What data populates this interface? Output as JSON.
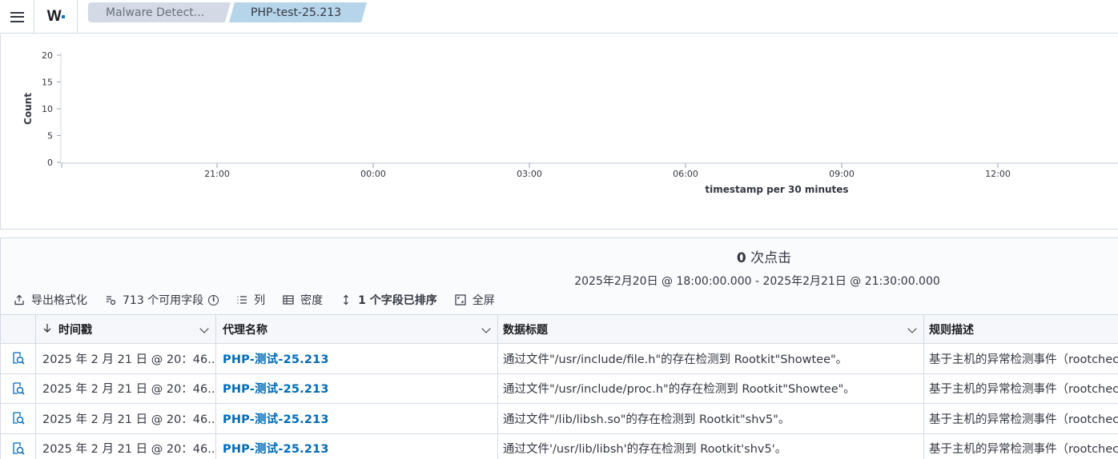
{
  "header": {
    "menu_icon": "hamburger-menu-icon",
    "logo_text": "W",
    "brand_color": "#0077cc",
    "breadcrumbs": [
      "Malware Detect...",
      "PHP-test-25.213"
    ]
  },
  "chart_data": {
    "type": "bar",
    "title": "",
    "xlabel": "timestamp per 30 minutes",
    "ylabel": "Count",
    "ylim": [
      0,
      20
    ],
    "y_ticks": [
      "0",
      "5",
      "10",
      "15",
      "20"
    ],
    "x_ticks": [
      "21:00",
      "00:00",
      "03:00",
      "06:00",
      "09:00",
      "12:00"
    ],
    "series": [],
    "grid": false
  },
  "hits": {
    "count": "0",
    "label": " 次点击",
    "time_range": "2025年2月20日 @ 18:00:00.000 - 2025年2月21日 @ 21:30:00.000"
  },
  "toolbar": {
    "export_label": "导出格式化",
    "fields_label": "713 个可用字段",
    "columns_label": "列",
    "density_label": "密度",
    "sort_label": "1 个字段已排序",
    "fullscreen_label": "全屏"
  },
  "table": {
    "columns": [
      "时间戳",
      "代理名称",
      "数据标题",
      "规则描述"
    ],
    "rows": [
      {
        "timestamp": "2025 年 2 月 21 日 @ 20：46...",
        "agent": "PHP-测试-25.213",
        "title": "通过文件\"/usr/include/file.h\"的存在检测到 Rootkit\"Showtee\"。",
        "rule": "基于主机的异常检测事件（rootcheck）"
      },
      {
        "timestamp": "2025 年 2 月 21 日 @ 20：46...",
        "agent": "PHP-测试-25.213",
        "title": "通过文件\"/usr/include/proc.h\"的存在检测到 Rootkit\"Showtee\"。",
        "rule": "基于主机的异常检测事件（rootcheck）"
      },
      {
        "timestamp": "2025 年 2 月 21 日 @ 20：46...",
        "agent": "PHP-测试-25.213",
        "title": "通过文件\"/lib/libsh.so\"的存在检测到 Rootkit\"shv5\"。",
        "rule": "基于主机的异常检测事件（rootcheck）"
      },
      {
        "timestamp": "2025 年 2 月 21 日 @ 20：46...",
        "agent": "PHP-测试-25.213",
        "title": "通过文件'/usr/lib/libsh'的存在检测到 Rootkit'shv5'。",
        "rule": "基于主机的异常检测事件（rootcheck）"
      }
    ]
  }
}
